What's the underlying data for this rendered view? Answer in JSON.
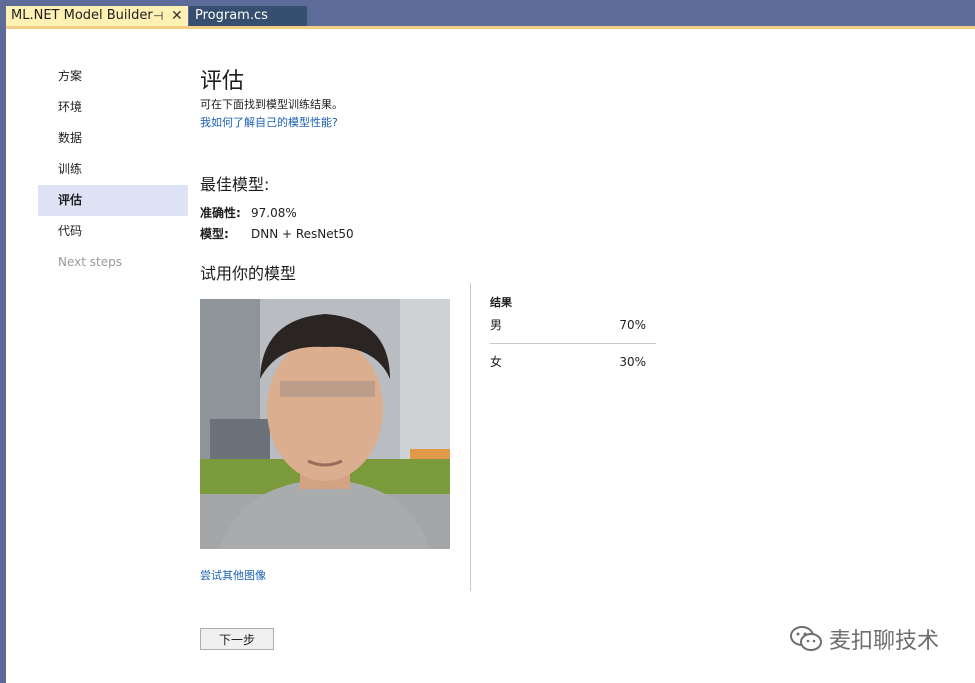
{
  "tabs": [
    {
      "label": "ML.NET Model Builder",
      "pin": "⊣",
      "close": "✕",
      "active": true
    },
    {
      "label": "Program.cs",
      "active": false
    }
  ],
  "nav": {
    "items": [
      {
        "label": "方案"
      },
      {
        "label": "环境"
      },
      {
        "label": "数据"
      },
      {
        "label": "训练"
      },
      {
        "label": "评估",
        "selected": true
      },
      {
        "label": "代码"
      },
      {
        "label": "Next steps",
        "disabled": true
      }
    ]
  },
  "page": {
    "title": "评估",
    "description": "可在下面找到模型训练结果。",
    "help_link": "我如何了解自己的模型性能?"
  },
  "best_model": {
    "title": "最佳模型:",
    "accuracy_label": "准确性:",
    "accuracy_value": "97.08%",
    "model_label": "模型:",
    "model_value": "DNN + ResNet50"
  },
  "try_model": {
    "title": "试用你的模型",
    "try_other_link": "尝试其他图像"
  },
  "results": {
    "header": "结果",
    "rows": [
      {
        "label": "男",
        "value": "70%"
      },
      {
        "label": "女",
        "value": "30%"
      }
    ]
  },
  "next_button": "下一步",
  "watermark": "麦扣聊技术",
  "icons": {
    "watermark": "wechat-icon"
  }
}
